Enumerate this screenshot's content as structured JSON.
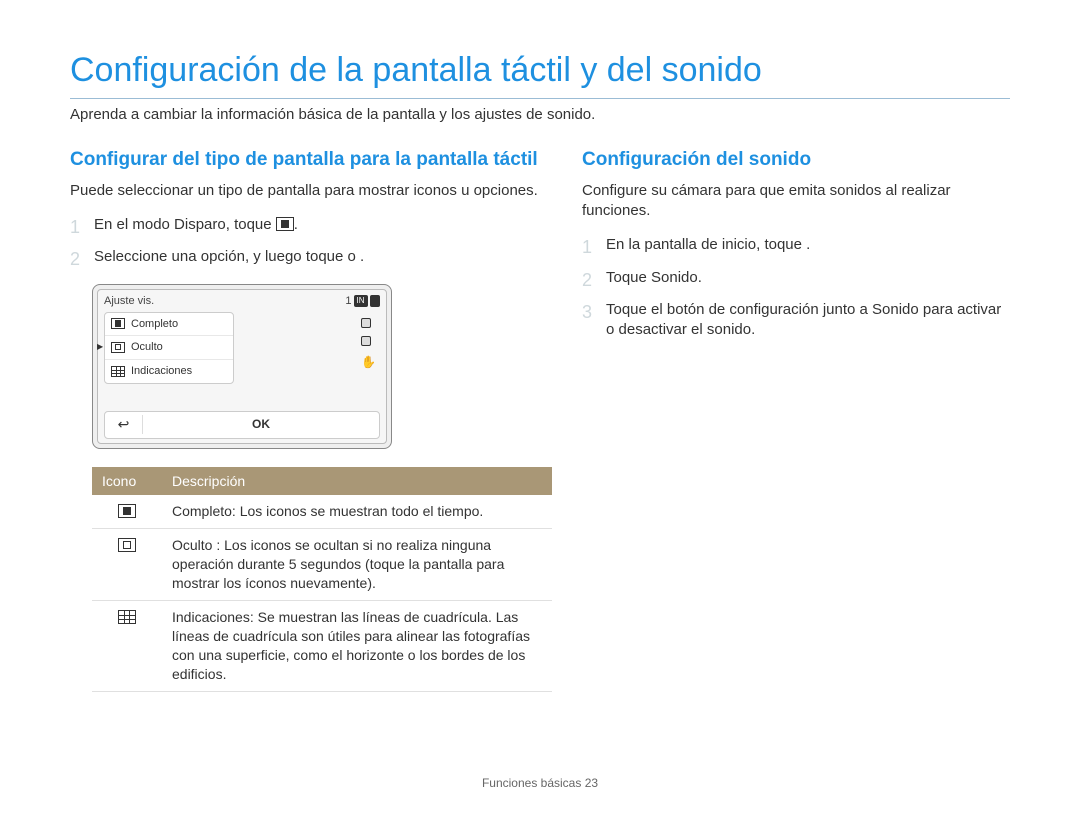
{
  "title": "Conﬁguración de la pantalla táctil y del sonido",
  "intro": "Aprenda a cambiar la información básica de la pantalla y los ajustes de sonido.",
  "left": {
    "subhead": "Conﬁgurar del tipo de pantalla para la pantalla táctil",
    "desc": "Puede seleccionar un tipo de pantalla para mostrar iconos u opciones.",
    "steps": [
      "En el modo Disparo, toque ",
      "Seleccione una opción, y luego toque o    ."
    ],
    "step1_suffix": ".",
    "camera": {
      "top_label": "Ajuste vis.",
      "top_count": "1",
      "badge": "IN",
      "items": [
        "Completo",
        "Oculto",
        "Indicaciones"
      ],
      "ok": "OK"
    },
    "table": {
      "head": {
        "c1": "Icono",
        "c2": "Descripción"
      },
      "rows": [
        {
          "text": "Completo: Los iconos se muestran todo el tiempo."
        },
        {
          "text": "Oculto : Los iconos se ocultan si no realiza ninguna operación durante 5 segundos (toque la pantalla para mostrar los íconos nuevamente)."
        },
        {
          "text": "Indicaciones: Se muestran las líneas de cuadrícula. Las líneas de cuadrícula son útiles para alinear las fotografías con una superﬁcie, como el horizonte o los bordes de los ediﬁcios."
        }
      ]
    }
  },
  "right": {
    "subhead": "Conﬁguración del sonido",
    "desc": "Conﬁgure su cámara para que emita sonidos al realizar funciones.",
    "steps": [
      "En la pantalla de inicio, toque    .",
      "Toque Sonido.",
      "Toque el botón de conﬁguración junto a Sonido para activar o desactivar el sonido."
    ]
  },
  "footer": {
    "label": "Funciones básicas",
    "page": "23"
  }
}
